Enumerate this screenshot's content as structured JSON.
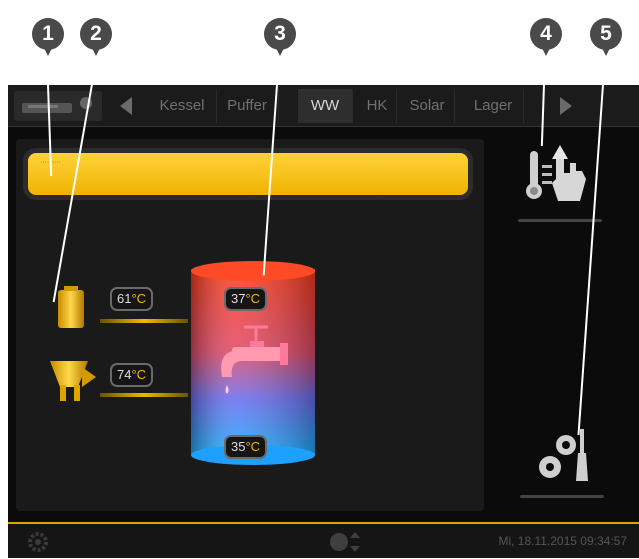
{
  "callouts": [
    "1",
    "2",
    "3",
    "4",
    "5"
  ],
  "tabs": [
    "Kessel",
    "Puffer",
    "WW",
    "HK",
    "Solar",
    "Lager"
  ],
  "active_tab": "WW",
  "info_bar_text": "·········",
  "inputs": {
    "boiler_temp": {
      "value": "61",
      "unit": "°C"
    },
    "solar_temp": {
      "value": "74",
      "unit": "°C"
    }
  },
  "tank": {
    "top_temp": {
      "value": "37",
      "unit": "°C"
    },
    "bottom_temp": {
      "value": "35",
      "unit": "°C"
    }
  },
  "status": {
    "datetime": "Mi, 18.11.2015 09:34:57"
  },
  "colors": {
    "accent": "#f2b800",
    "tank_hot": "#e8452a",
    "tank_cold": "#2aa8ff"
  }
}
